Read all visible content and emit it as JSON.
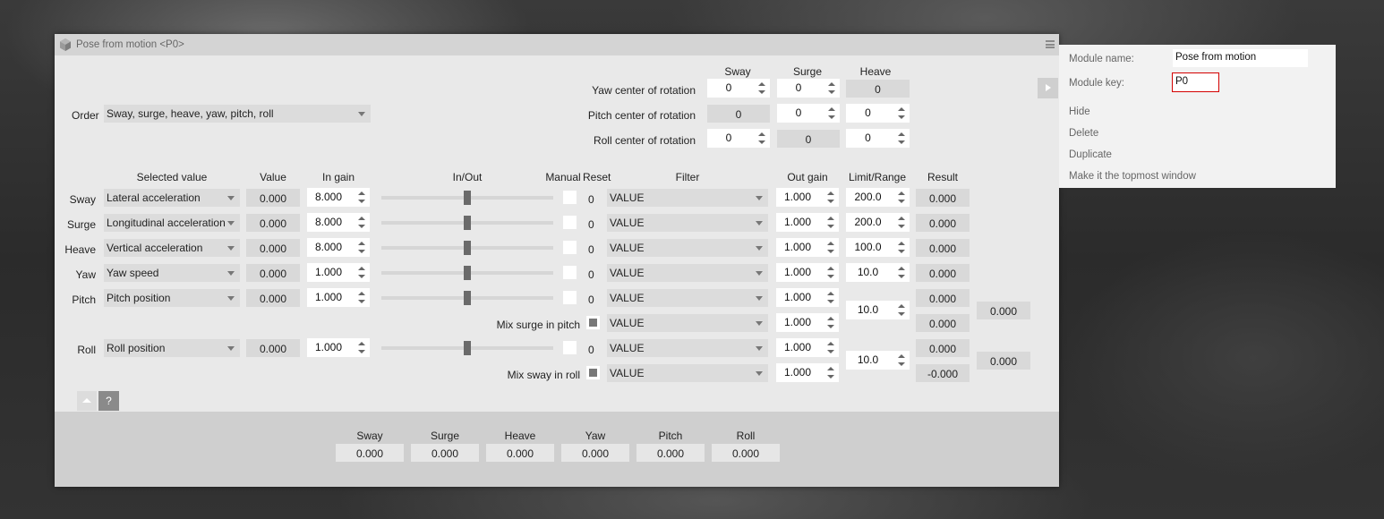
{
  "window": {
    "title": "Pose from motion <P0>",
    "icons": {
      "logo": "module-cube-icon",
      "menu": "hamburger-icon"
    }
  },
  "order": {
    "label": "Order",
    "value": "Sway, surge, heave, yaw, pitch, roll"
  },
  "center_of_rotation": {
    "headers": [
      "Sway",
      "Surge",
      "Heave"
    ],
    "rows": [
      {
        "label": "Yaw center of rotation",
        "sway": "0",
        "surge": "0",
        "heave": "0"
      },
      {
        "label": "Pitch center of rotation",
        "sway": "0",
        "surge": "0",
        "heave": "0"
      },
      {
        "label": "Roll center of rotation",
        "sway": "0",
        "surge": "0",
        "heave": "0"
      }
    ]
  },
  "table": {
    "headers": {
      "selected_value": "Selected value",
      "value": "Value",
      "in_gain": "In gain",
      "in_out": "In/Out",
      "manual": "Manual",
      "reset": "Reset",
      "filter": "Filter",
      "out_gain": "Out gain",
      "limit_range": "Limit/Range",
      "result": "Result"
    },
    "rows": [
      {
        "axis": "Sway",
        "selected": "Lateral acceleration",
        "value": "0.000",
        "in_gain": "8.000",
        "slider": 0.5,
        "manual": false,
        "reset": "0",
        "filter": "VALUE",
        "out_gain": "1.000",
        "limit": "200.0",
        "result": "0.000"
      },
      {
        "axis": "Surge",
        "selected": "Longitudinal acceleration",
        "value": "0.000",
        "in_gain": "8.000",
        "slider": 0.5,
        "manual": false,
        "reset": "0",
        "filter": "VALUE",
        "out_gain": "1.000",
        "limit": "200.0",
        "result": "0.000"
      },
      {
        "axis": "Heave",
        "selected": "Vertical acceleration",
        "value": "0.000",
        "in_gain": "8.000",
        "slider": 0.5,
        "manual": false,
        "reset": "0",
        "filter": "VALUE",
        "out_gain": "1.000",
        "limit": "100.0",
        "result": "0.000"
      },
      {
        "axis": "Yaw",
        "selected": "Yaw speed",
        "value": "0.000",
        "in_gain": "1.000",
        "slider": 0.5,
        "manual": false,
        "reset": "0",
        "filter": "VALUE",
        "out_gain": "1.000",
        "limit": "10.0",
        "result": "0.000"
      },
      {
        "axis": "Pitch",
        "selected": "Pitch position",
        "value": "0.000",
        "in_gain": "1.000",
        "slider": 0.5,
        "manual": false,
        "reset": "0",
        "filter": "VALUE",
        "out_gain": "1.000",
        "result": "0.000"
      },
      {
        "axis": "Roll",
        "selected": "Roll position",
        "value": "0.000",
        "in_gain": "1.000",
        "slider": 0.5,
        "manual": false,
        "reset": "0",
        "filter": "VALUE",
        "out_gain": "1.000",
        "result": "0.000"
      }
    ],
    "mix_surge": {
      "label": "Mix surge in pitch",
      "checked": true,
      "filter": "VALUE",
      "out_gain": "1.000",
      "result": "0.000"
    },
    "mix_sway": {
      "label": "Mix sway in roll",
      "checked": true,
      "filter": "VALUE",
      "out_gain": "1.000",
      "result": "-0.000"
    },
    "pitch_limit": "10.0",
    "pitch_total": "0.000",
    "roll_limit": "10.0",
    "roll_total": "0.000"
  },
  "buttons": {
    "collapse_icon": "triangle-up-icon",
    "help": "?",
    "expand_icon": "triangle-right-icon"
  },
  "footer": {
    "labels": [
      "Sway",
      "Surge",
      "Heave",
      "Yaw",
      "Pitch",
      "Roll"
    ],
    "values": [
      "0.000",
      "0.000",
      "0.000",
      "0.000",
      "0.000",
      "0.000"
    ]
  },
  "panel": {
    "name_label": "Module name:",
    "name_value": "Pose from motion",
    "key_label": "Module key:",
    "key_value": "P0",
    "key_border_color": "#d40000",
    "items": [
      "Hide",
      "Delete",
      "Duplicate",
      "Make it the topmost window"
    ]
  }
}
